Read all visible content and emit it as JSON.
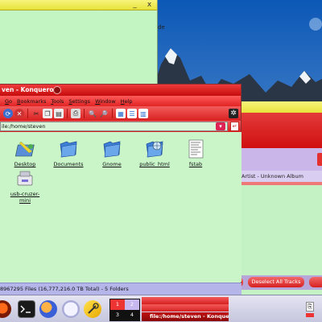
{
  "background_window": {
    "side_fragment": "de",
    "minimize": "_",
    "close": "x"
  },
  "konqueror": {
    "title": "ven - Konqueror",
    "menu": [
      "Go",
      "Bookmarks",
      "Tools",
      "Settings",
      "Window",
      "Help"
    ],
    "location": "ile:/home/steven",
    "files": [
      {
        "name": "Desktop",
        "icon": "desktop-folder-icon"
      },
      {
        "name": "Documents",
        "icon": "folder-icon"
      },
      {
        "name": "Gnome",
        "icon": "folder-icon"
      },
      {
        "name": "public_html",
        "icon": "globe-folder-icon"
      },
      {
        "name": "fstab",
        "icon": "text-file-icon"
      },
      {
        "name": "usb-cruzer-mini",
        "icon": "usb-drive-icon"
      }
    ],
    "status": "8967295 Files (16,777,216.0 TB Total) - 5 Folders"
  },
  "media_player": {
    "info": "Artist - Unknown Album",
    "deselect_button": "Deselect All Tracks"
  },
  "taskbar": {
    "pager": [
      "1",
      "2",
      "3",
      "4"
    ],
    "tasks": [
      "",
      "",
      "file:/home/steven - Konqueror"
    ]
  },
  "colors": {
    "accent_red": "#d62020",
    "titlebar_yellow": "#ece63e",
    "panel_green": "#c9f5c9",
    "status_purple": "#b5b5ea"
  }
}
